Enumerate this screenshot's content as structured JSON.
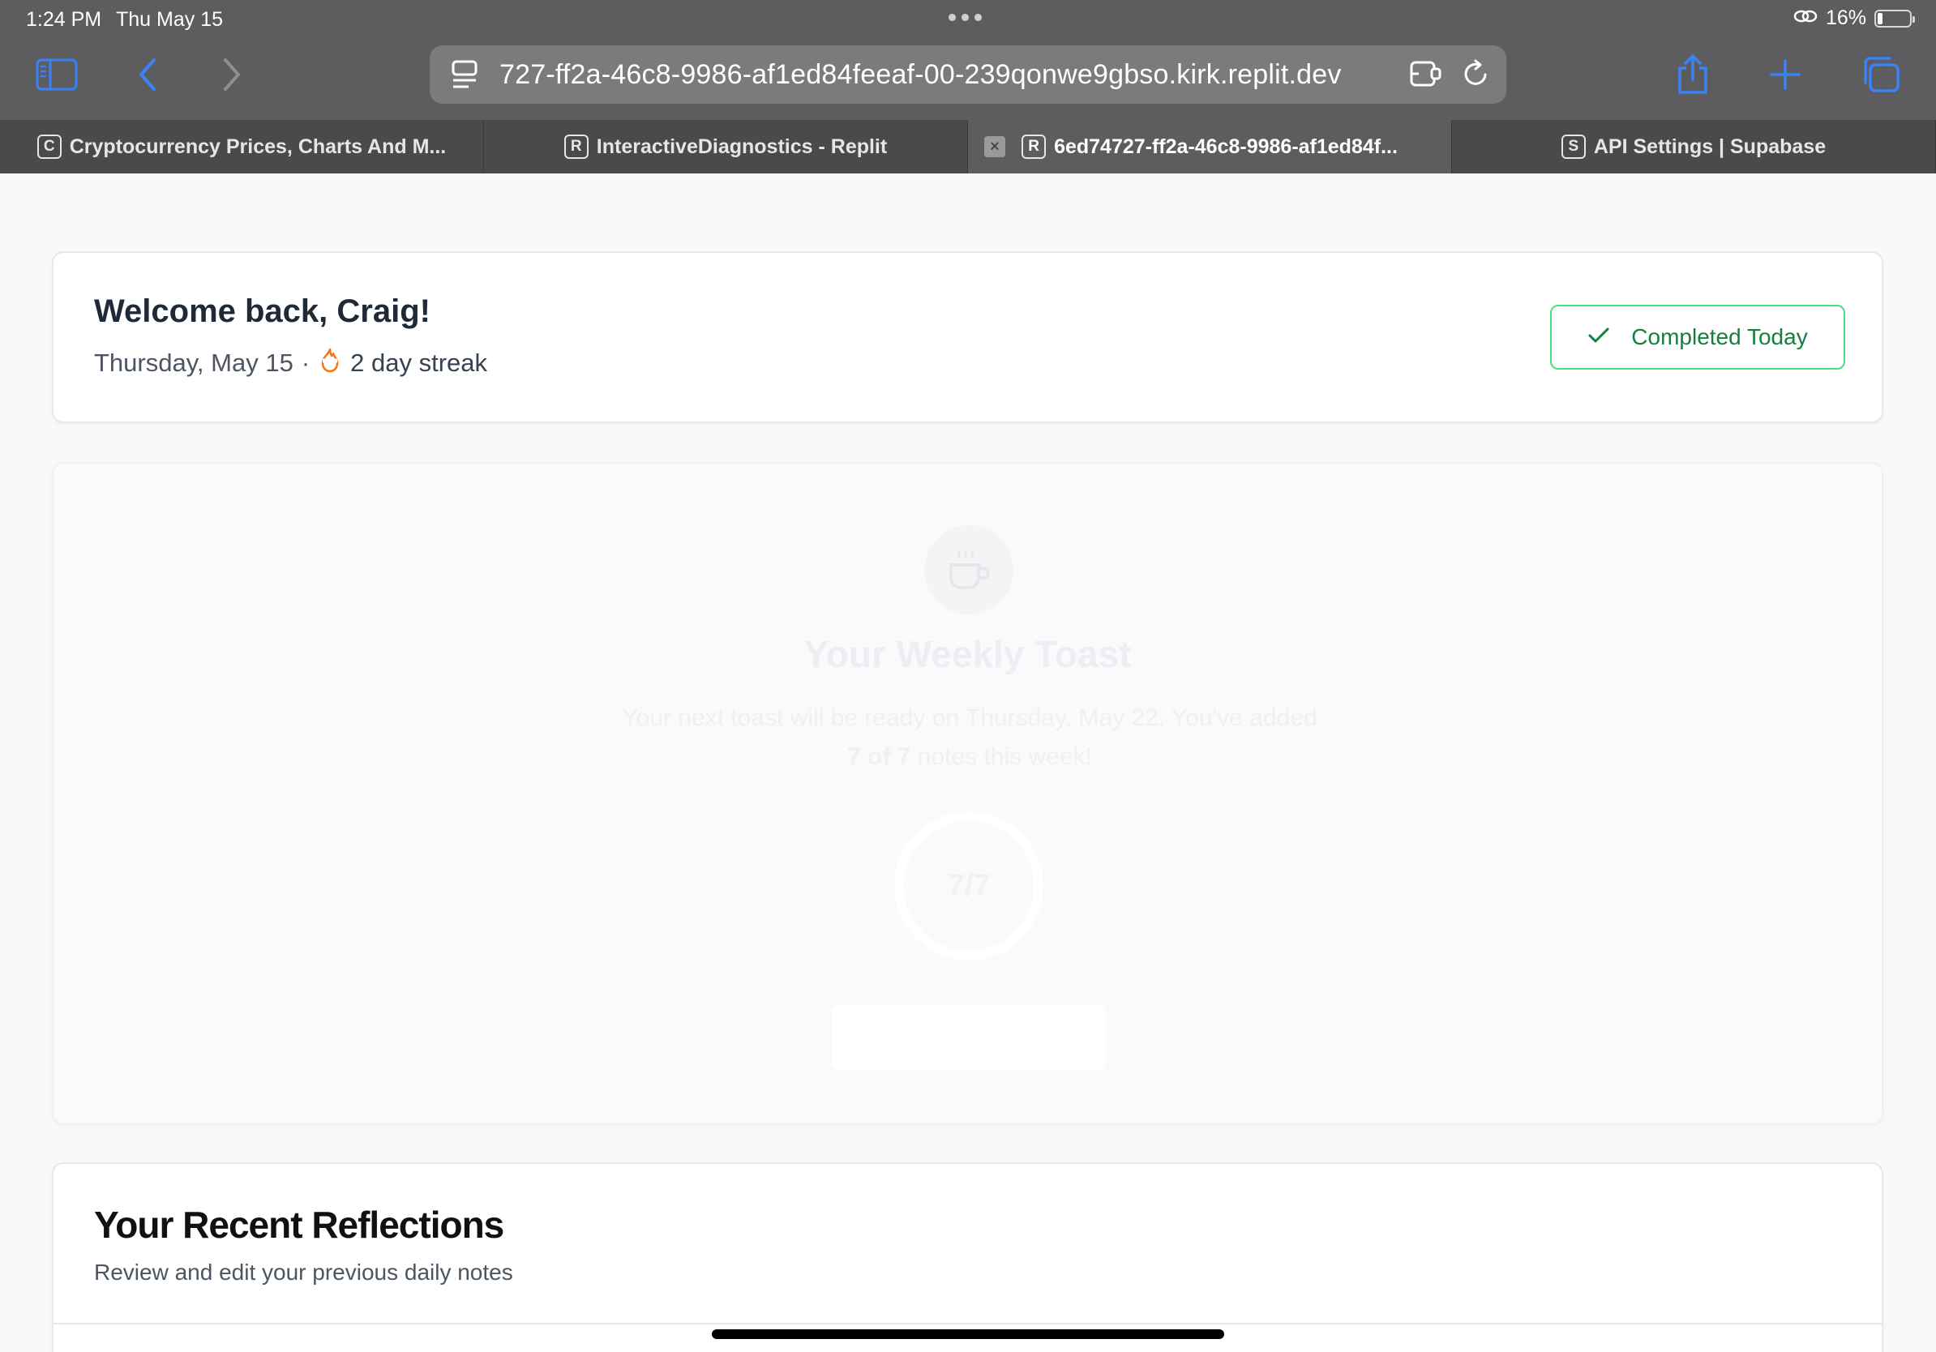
{
  "status_bar": {
    "time": "1:24 PM",
    "date": "Thu May 15",
    "battery_percent": "16%",
    "battery_level": 0.16
  },
  "browser": {
    "url": "727-ff2a-46c8-9986-af1ed84feeaf-00-239qonwe9gbso.kirk.replit.dev",
    "tabs": [
      {
        "favicon": "C",
        "label": "Cryptocurrency Prices, Charts And M...",
        "active": false
      },
      {
        "favicon": "R",
        "label": "InteractiveDiagnostics - Replit",
        "active": false
      },
      {
        "favicon": "R",
        "label": "6ed74727-ff2a-46c8-9986-af1ed84f...",
        "active": true
      },
      {
        "favicon": "S",
        "label": "API Settings | Supabase",
        "active": false
      }
    ],
    "icons": [
      "sidebar-icon",
      "back-icon",
      "forward-icon",
      "page-menu-icon",
      "extension-icon",
      "reload-icon",
      "share-icon",
      "new-tab-icon",
      "tab-overview-icon"
    ]
  },
  "welcome": {
    "title": "Welcome back, Craig!",
    "date_text": "Thursday, May 15",
    "separator": "·",
    "streak_text": "2 day streak",
    "completed_label": "Completed Today"
  },
  "toast": {
    "title": "Your Weekly Toast",
    "desc_prefix": "Your next toast will be ready on Thursday, May 22. You've added ",
    "desc_bold": "7 of 7",
    "desc_suffix": " notes this week!",
    "progress_label": "7/7",
    "progress_fraction": 1.0,
    "icon": "coffee-cup-icon"
  },
  "reflections": {
    "title": "Your Recent Reflections",
    "subtitle": "Review and edit your previous daily notes"
  },
  "colors": {
    "accent_blue": "#3b82f6",
    "success_green": "#15803d",
    "success_border": "#4ade80",
    "streak_orange": "#f97316"
  }
}
